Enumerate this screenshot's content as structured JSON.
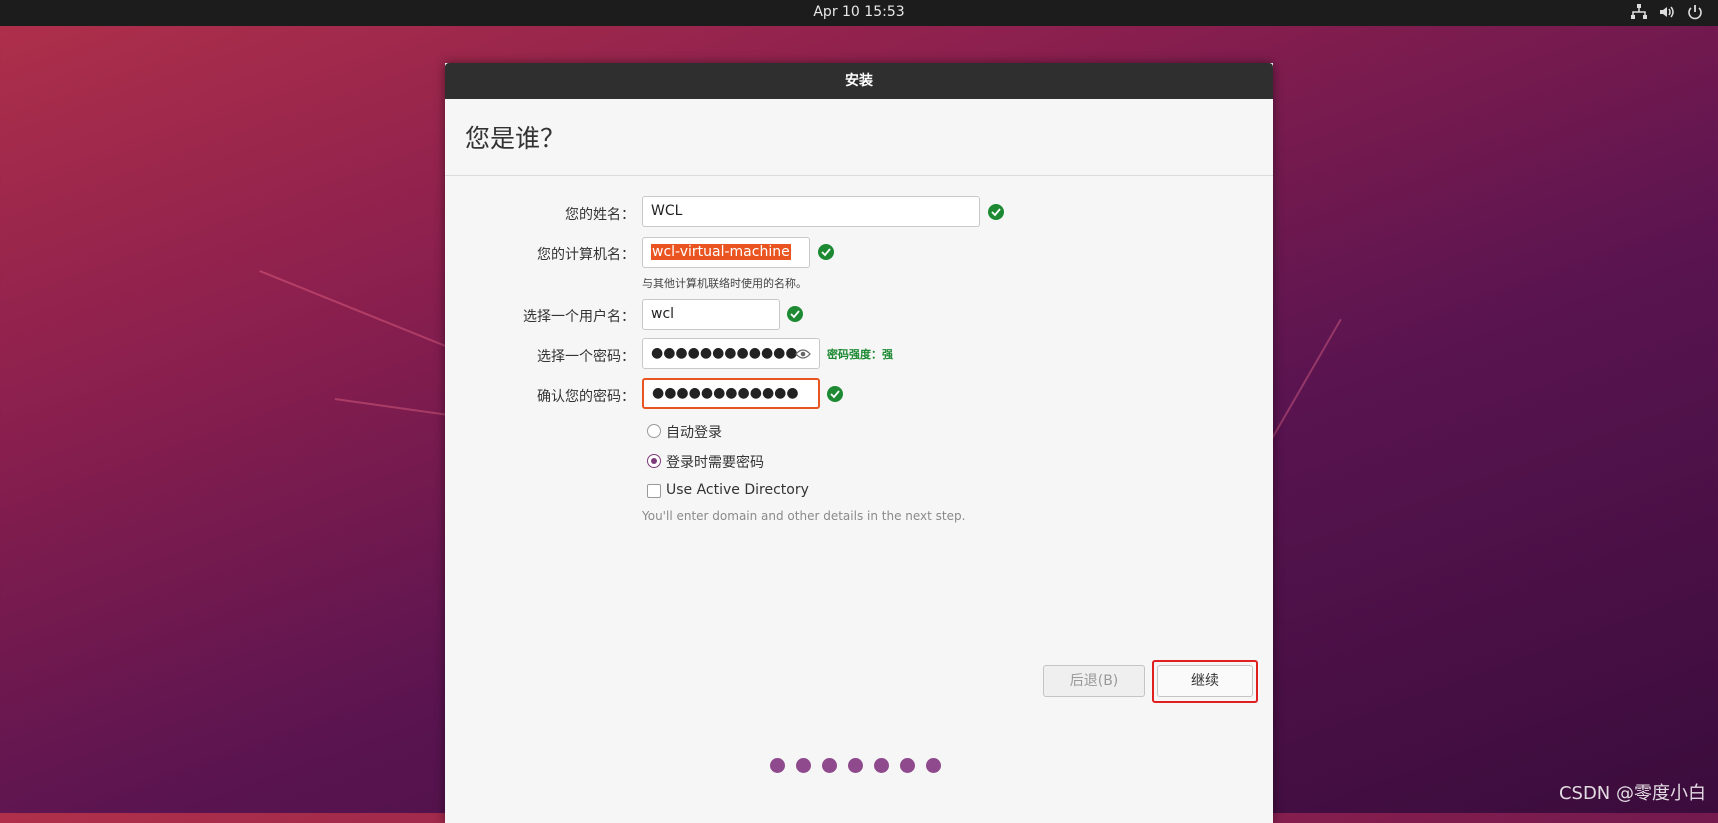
{
  "topbar": {
    "clock": "Apr 10  15:53",
    "icons": [
      "network-icon",
      "volume-icon",
      "power-icon"
    ]
  },
  "window": {
    "title": "安装",
    "page_title": "您是谁？",
    "fields": {
      "name_label": "您的姓名：",
      "name_value": "WCL",
      "computer_label": "您的计算机名：",
      "computer_value": "wcl-virtual-machine",
      "computer_hint": "与其他计算机联络时使用的名称。",
      "username_label": "选择一个用户名：",
      "username_value": "wcl",
      "password_label": "选择一个密码：",
      "password_value": "●●●●●●●●●●●●",
      "password_strength": "密码强度：强",
      "confirm_label": "确认您的密码：",
      "confirm_value": "●●●●●●●●●●●●"
    },
    "options": {
      "auto_login": "自动登录",
      "require_password": "登录时需要密码",
      "active_directory": "Use Active Directory",
      "active_directory_hint": "You'll enter domain and other details in the next step.",
      "selected": "require_password",
      "active_directory_checked": false
    },
    "buttons": {
      "back": "后退(B)",
      "continue": "继续"
    },
    "progress": {
      "total_steps": 7
    }
  },
  "colors": {
    "accent": "#e95420",
    "ok": "#1d8a33",
    "purple": "#8e4a8c",
    "highlight": "#e02020"
  },
  "watermark": "CSDN @零度小白"
}
